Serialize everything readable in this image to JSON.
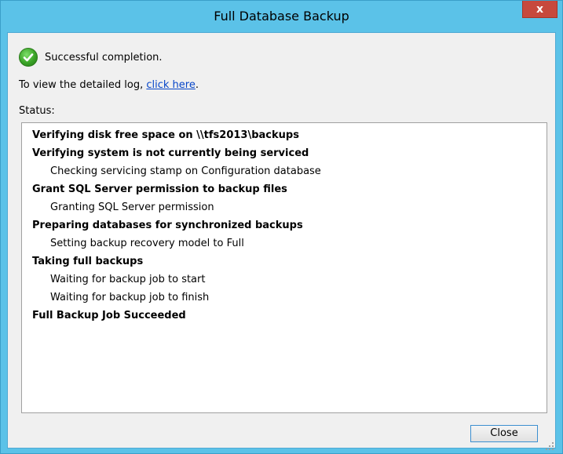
{
  "window": {
    "title": "Full Database Backup",
    "close_glyph": "x"
  },
  "result": {
    "icon": "success-check-icon",
    "message": "Successful completion."
  },
  "log": {
    "prefix": "To view the detailed log, ",
    "link_text": "click here",
    "suffix": "."
  },
  "status": {
    "label": "Status:",
    "lines": [
      {
        "text": "Verifying disk free space on \\\\tfs2013\\backups",
        "kind": "step"
      },
      {
        "text": "Verifying system is not currently being serviced",
        "kind": "step"
      },
      {
        "text": "Checking servicing stamp on Configuration database",
        "kind": "sub"
      },
      {
        "text": "Grant SQL Server permission to backup files",
        "kind": "step"
      },
      {
        "text": "Granting SQL Server permission",
        "kind": "sub"
      },
      {
        "text": "Preparing databases for synchronized backups",
        "kind": "step"
      },
      {
        "text": "Setting backup recovery model to Full",
        "kind": "sub"
      },
      {
        "text": "Taking full backups",
        "kind": "step"
      },
      {
        "text": "Waiting for backup job to start",
        "kind": "sub"
      },
      {
        "text": "Waiting for backup job to finish",
        "kind": "sub"
      },
      {
        "text": "Full Backup Job Succeeded",
        "kind": "step"
      }
    ]
  },
  "buttons": {
    "close_label": "Close"
  },
  "colors": {
    "title_bar": "#5bc2e8",
    "close_button_red": "#c7493d",
    "link": "#0645c8",
    "success_green": "#3aa327"
  }
}
